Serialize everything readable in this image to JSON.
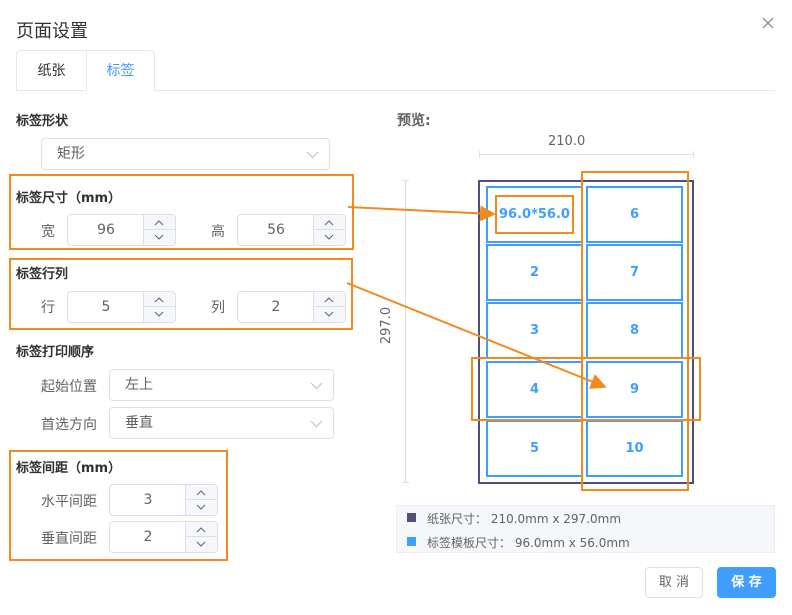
{
  "dialog": {
    "title": "页面设置"
  },
  "tabs": [
    {
      "label": "纸张"
    },
    {
      "label": "标签"
    }
  ],
  "shape": {
    "heading": "标签形状",
    "value": "矩形"
  },
  "size": {
    "heading": "标签尺寸（mm）",
    "width_label": "宽",
    "width_value": "96",
    "height_label": "高",
    "height_value": "56"
  },
  "grid": {
    "heading": "标签行列",
    "rows_label": "行",
    "rows_value": "5",
    "cols_label": "列",
    "cols_value": "2"
  },
  "order": {
    "heading": "标签打印顺序",
    "start_label": "起始位置",
    "start_value": "左上",
    "direction_label": "首选方向",
    "direction_value": "垂直"
  },
  "spacing": {
    "heading": "标签间距（mm）",
    "h_label": "水平间距",
    "h_value": "3",
    "v_label": "垂直间距",
    "v_value": "2"
  },
  "preview": {
    "heading": "预览:",
    "width_text": "210.0",
    "height_text": "297.0",
    "cells": [
      "96.0*56.0",
      "2",
      "3",
      "4",
      "5",
      "6",
      "7",
      "8",
      "9",
      "10"
    ]
  },
  "legend": {
    "paper": "纸张尺寸：  210.0mm x 297.0mm",
    "label": "标签模板尺寸：  96.0mm x 56.0mm"
  },
  "colors": {
    "accent": "#409eff",
    "paper_border": "#50507a",
    "highlight": "#f08a1c"
  },
  "buttons": {
    "cancel": "取 消",
    "save": "保 存"
  }
}
